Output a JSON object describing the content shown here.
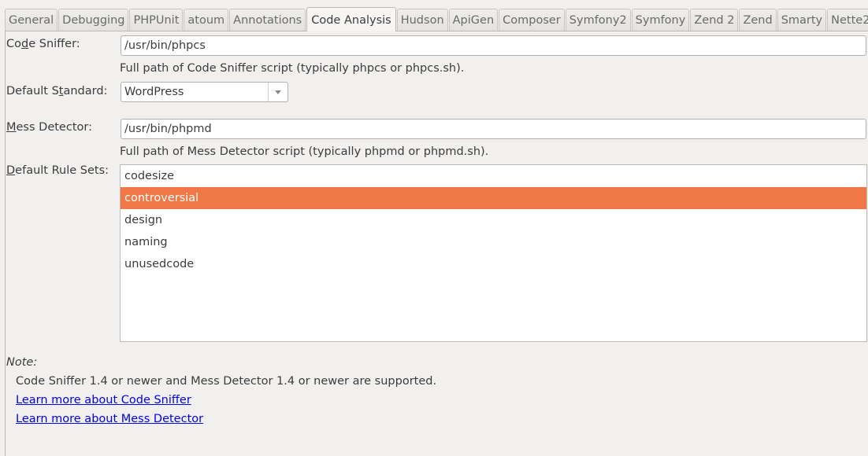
{
  "tabs": [
    {
      "label": "General",
      "active": false
    },
    {
      "label": "Debugging",
      "active": false
    },
    {
      "label": "PHPUnit",
      "active": false
    },
    {
      "label": "atoum",
      "active": false
    },
    {
      "label": "Annotations",
      "active": false
    },
    {
      "label": "Code Analysis",
      "active": true
    },
    {
      "label": "Hudson",
      "active": false
    },
    {
      "label": "ApiGen",
      "active": false
    },
    {
      "label": "Composer",
      "active": false
    },
    {
      "label": "Symfony2",
      "active": false
    },
    {
      "label": "Symfony",
      "active": false
    },
    {
      "label": "Zend 2",
      "active": false
    },
    {
      "label": "Zend",
      "active": false
    },
    {
      "label": "Smarty",
      "active": false
    },
    {
      "label": "Nette2",
      "active": false
    }
  ],
  "code_sniffer": {
    "label_pre": "Co",
    "label_mnemonic": "d",
    "label_post": "e Sniffer:",
    "value": "/usr/bin/phpcs",
    "hint": "Full path of Code Sniffer script (typically phpcs or phpcs.sh)."
  },
  "default_standard": {
    "label_pre": "Default S",
    "label_mnemonic": "t",
    "label_post": "andard:",
    "value": "WordPress"
  },
  "mess_detector": {
    "label_pre": "",
    "label_mnemonic": "M",
    "label_post": "ess Detector:",
    "value": "/usr/bin/phpmd",
    "hint": "Full path of Mess Detector script (typically phpmd or phpmd.sh)."
  },
  "rule_sets": {
    "label_pre": "",
    "label_mnemonic": "D",
    "label_post": "efault Rule Sets:",
    "items": [
      "codesize",
      "controversial",
      "design",
      "naming",
      "unusedcode"
    ],
    "selected": "controversial",
    "selection_color": "#f07746"
  },
  "note": {
    "label": "Note:",
    "text": "Code Sniffer 1.4 or newer and Mess Detector 1.4 or newer are supported.",
    "links": [
      "Learn more about Code Sniffer",
      "Learn more about Mess Detector"
    ]
  }
}
